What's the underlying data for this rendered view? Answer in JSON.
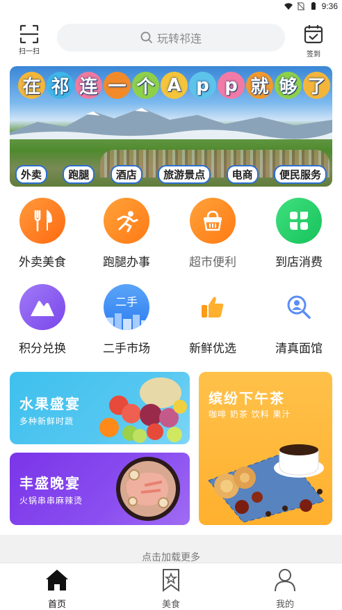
{
  "status_bar": {
    "time": "9:36",
    "icons": [
      "wifi-icon",
      "no-sim-icon",
      "battery-icon"
    ]
  },
  "header": {
    "scan_label": "扫一扫",
    "search_placeholder": "玩转祁连",
    "checkin_label": "签到"
  },
  "banner": {
    "title_chars": [
      "在",
      "祁",
      "连",
      "一",
      "个",
      "A",
      "p",
      "p",
      "就",
      "够",
      "了"
    ],
    "tags": [
      "外卖",
      "跑腿",
      "酒店",
      "旅游景点",
      "电商",
      "便民服务"
    ]
  },
  "grid": [
    {
      "label": "外卖美食",
      "icon": "fork-knife-icon",
      "color": "#ff7a1a",
      "muted": false
    },
    {
      "label": "跑腿办事",
      "icon": "runner-icon",
      "color": "#ff8a1f",
      "muted": false
    },
    {
      "label": "超市便利",
      "icon": "basket-icon",
      "color": "#ff8a1f",
      "muted": true
    },
    {
      "label": "到店消费",
      "icon": "store-grid-icon",
      "color": "#2fd46f",
      "muted": false
    },
    {
      "label": "积分兑换",
      "icon": "mountain-points-icon",
      "color": "#8e5cf0",
      "muted": false
    },
    {
      "label": "二手市场",
      "icon": "secondhand-icon",
      "color": "#3d8ef5",
      "muted": false
    },
    {
      "label": "新鲜优选",
      "icon": "thumbs-up-icon",
      "color": "#ff9a1a",
      "muted": false
    },
    {
      "label": "清真面馆",
      "icon": "magnifier-person-icon",
      "color": "#3d7cf5",
      "muted": false
    }
  ],
  "secondhand_text": "二手",
  "cards": {
    "fruit": {
      "title": "水果盛宴",
      "subtitle": "多种新鲜时蔬"
    },
    "dinner": {
      "title": "丰盛晚宴",
      "subtitle": "火锅串串麻辣烫"
    },
    "tea": {
      "title": "缤纷下午茶",
      "subtitle": "咖啡 奶茶 饮料 果汁"
    }
  },
  "load_more": "点击加载更多",
  "tabs": [
    {
      "label": "首页",
      "icon": "home-icon",
      "active": true
    },
    {
      "label": "美食",
      "icon": "bookmark-star-icon",
      "active": false
    },
    {
      "label": "我的",
      "icon": "user-icon",
      "active": false
    }
  ]
}
